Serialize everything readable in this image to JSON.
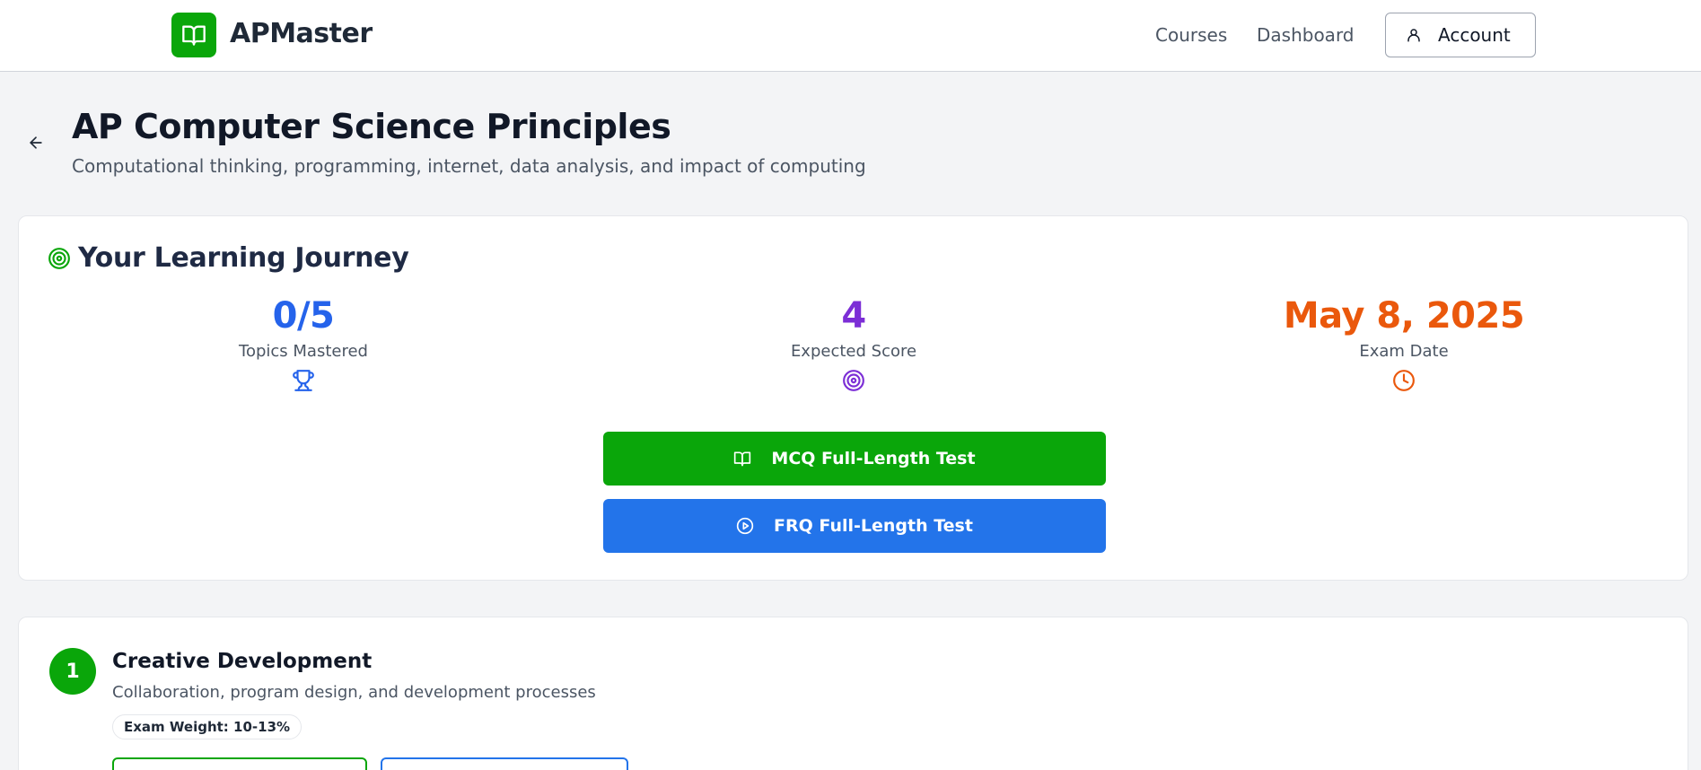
{
  "header": {
    "brand": "APMaster",
    "nav": {
      "courses": "Courses",
      "dashboard": "Dashboard"
    },
    "account_label": "Account"
  },
  "page": {
    "title": "AP Computer Science Principles",
    "subtitle": "Computational thinking, programming, internet, data analysis, and impact of computing"
  },
  "journey": {
    "title": "Your Learning Journey",
    "stats": [
      {
        "value": "0/5",
        "label": "Topics Mastered",
        "icon": "trophy-icon",
        "color": "#2563eb"
      },
      {
        "value": "4",
        "label": "Expected Score",
        "icon": "target-icon",
        "color": "#7c2ed6"
      },
      {
        "value": "May 8, 2025",
        "label": "Exam Date",
        "icon": "clock-icon",
        "color": "#ea580c"
      }
    ],
    "mcq_label": "MCQ Full-Length Test",
    "frq_label": "FRQ Full-Length Test"
  },
  "units": [
    {
      "number": "1",
      "title": "Creative Development",
      "description": "Collaboration, program design, and development processes",
      "weight": "Exam Weight: 10-13%"
    }
  ],
  "colors": {
    "brand_green": "#0aa60a",
    "blue": "#2374ea",
    "purple": "#7c2ed6",
    "orange": "#ea580c",
    "background": "#f3f4f6"
  }
}
